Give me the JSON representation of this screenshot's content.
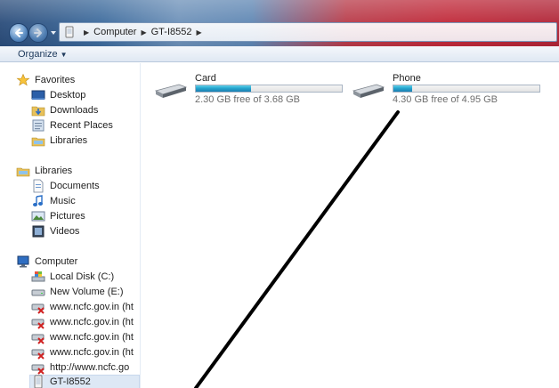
{
  "address": {
    "crumbs": [
      "Computer",
      "GT-I8552"
    ]
  },
  "toolbar": {
    "organize_label": "Organize"
  },
  "nav": {
    "favorites": {
      "label": "Favorites",
      "items": [
        "Desktop",
        "Downloads",
        "Recent Places",
        "Libraries"
      ]
    },
    "libraries": {
      "label": "Libraries",
      "items": [
        "Documents",
        "Music",
        "Pictures",
        "Videos"
      ]
    },
    "computer": {
      "label": "Computer",
      "items": [
        "Local Disk (C:)",
        "New Volume (E:)",
        "www.ncfc.gov.in (ht",
        "www.ncfc.gov.in (ht",
        "www.ncfc.gov.in (ht",
        "www.ncfc.gov.in (ht",
        "http://www.ncfc.go",
        "GT-I8552"
      ]
    }
  },
  "drives": [
    {
      "name": "Card",
      "free_text": "2.30 GB free of 3.68 GB",
      "used_fraction": 0.375
    },
    {
      "name": "Phone",
      "free_text": "4.30 GB free of 4.95 GB",
      "used_fraction": 0.131
    }
  ],
  "colors": {
    "bar_fill": "#27a6cf",
    "selected_bg": "#dde8f5"
  }
}
